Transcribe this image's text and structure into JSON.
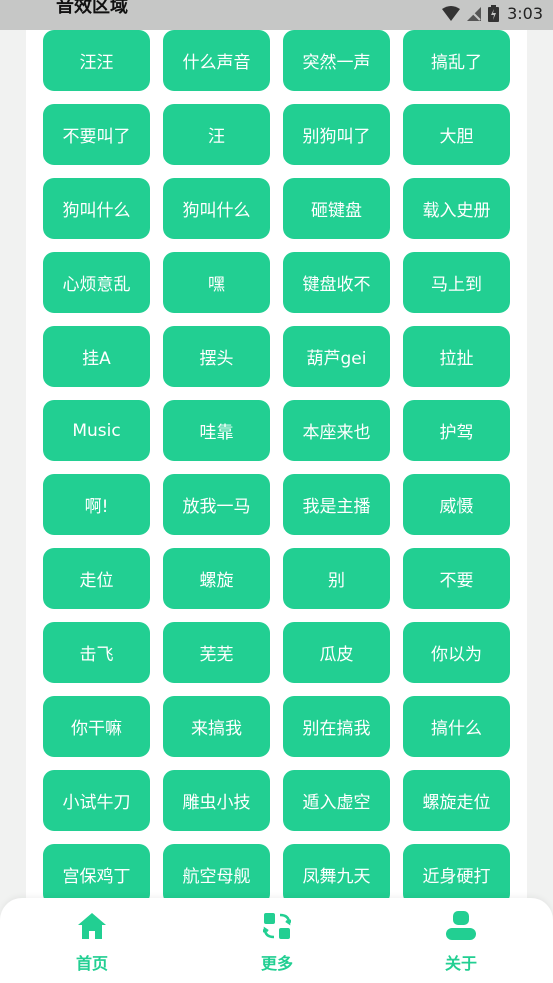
{
  "header": {
    "section_title": "音效区域",
    "time": "3:03"
  },
  "sound_buttons": [
    "汪汪",
    "什么声音",
    "突然一声",
    "搞乱了",
    "不要叫了",
    "汪",
    "别狗叫了",
    "大胆",
    "狗叫什么",
    "狗叫什么",
    "砸键盘",
    "载入史册",
    "心烦意乱",
    "嘿",
    "键盘收不",
    "马上到",
    "挂A",
    "摆头",
    "葫芦gei",
    "拉扯",
    "Music",
    "哇靠",
    "本座来也",
    "护驾",
    "啊!",
    "放我一马",
    "我是主播",
    "威慑",
    "走位",
    "螺旋",
    "别",
    "不要",
    "击飞",
    "芜芜",
    "瓜皮",
    "你以为",
    "你干嘛",
    "来搞我",
    "别在搞我",
    "搞什么",
    "小试牛刀",
    "雕虫小技",
    "遁入虚空",
    "螺旋走位",
    "宫保鸡丁",
    "航空母舰",
    "凤舞九天",
    "近身硬打"
  ],
  "nav": [
    {
      "label": "首页",
      "icon": "home-icon"
    },
    {
      "label": "更多",
      "icon": "refresh-grid-icon"
    },
    {
      "label": "关于",
      "icon": "user-icon"
    }
  ],
  "colors": {
    "accent": "#22cf92",
    "background": "#f1f2f1",
    "card": "#ffffff"
  }
}
